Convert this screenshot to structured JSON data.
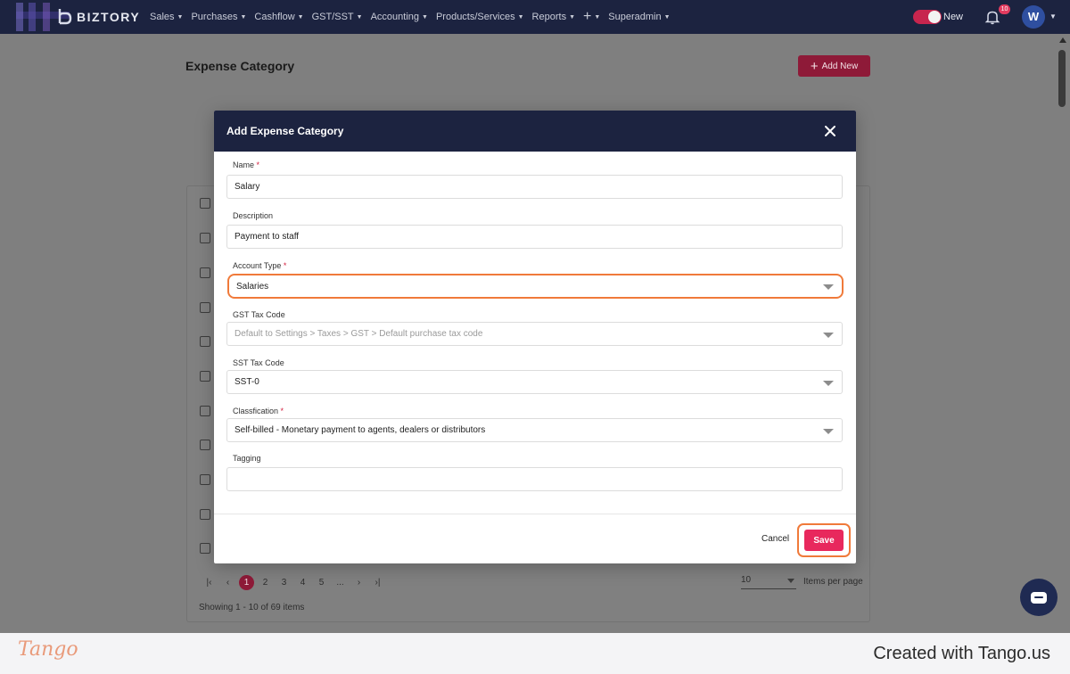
{
  "app": {
    "name": "BIZTORY"
  },
  "nav": {
    "items": [
      "Sales",
      "Purchases",
      "Cashflow",
      "GST/SST",
      "Accounting",
      "Products/Services",
      "Reports",
      "Superadmin"
    ],
    "toggle_label": "New",
    "notification_count": "10",
    "avatar_initial": "W"
  },
  "page": {
    "title": "Expense Category",
    "add_new_label": "Add New",
    "pagination": {
      "pages": [
        "1",
        "2",
        "3",
        "4",
        "5",
        "..."
      ],
      "active_page": "1"
    },
    "per_page_value": "10",
    "per_page_label": "Items per page",
    "showing_text": "Showing 1 - 10 of 69 items"
  },
  "modal": {
    "title": "Add Expense Category",
    "fields": {
      "name": {
        "label": "Name",
        "value": "Salary",
        "required": "*"
      },
      "description": {
        "label": "Description",
        "value": "Payment to staff"
      },
      "account_type": {
        "label": "Account Type",
        "value": "Salaries",
        "required": "*"
      },
      "gst_tax_code": {
        "label": "GST Tax Code",
        "placeholder": "Default to Settings > Taxes > GST > Default purchase tax code"
      },
      "sst_tax_code": {
        "label": "SST Tax Code",
        "value": "SST-0"
      },
      "classification": {
        "label": "Classfication",
        "value": "Self-billed - Monetary payment to agents, dealers or distributors",
        "required": "*"
      },
      "tagging": {
        "label": "Tagging",
        "value": ""
      }
    },
    "cancel_label": "Cancel",
    "save_label": "Save"
  },
  "footer": {
    "logo": "Tango",
    "credit": "Created with Tango.us"
  },
  "colors": {
    "nav_bg": "#1c2340",
    "accent": "#e8285d",
    "highlight": "#f07a3a"
  }
}
